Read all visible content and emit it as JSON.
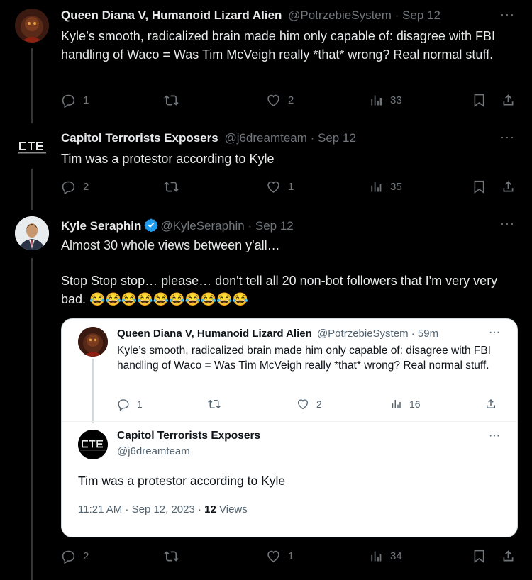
{
  "tweets": [
    {
      "name": "Queen Diana V, Humanoid Lizard Alien",
      "handle": "@PotrzebieSystem",
      "time": "Sep 12",
      "text": "Kyle’s smooth, radicalized brain made him only capable of: disagree with FBI handling of Waco = Was Tim McVeigh really *that* wrong? Real normal stuff.",
      "replies": "1",
      "retweets": "",
      "likes": "2",
      "views": "33"
    },
    {
      "name": "Capitol Terrorists Exposers",
      "handle": "@j6dreamteam",
      "time": "Sep 12",
      "text": "Tim was a protestor according to Kyle",
      "replies": "2",
      "retweets": "",
      "likes": "1",
      "views": "35"
    },
    {
      "name": "Kyle Seraphin",
      "handle": "@KyleSeraphin",
      "time": "Sep 12",
      "text_line1": "Almost 30 whole views between y'all…",
      "text_line2": "Stop Stop stop… please… don't tell all 20 non-bot followers that I'm very very bad. 😂😂😂😂😂😂😂😂😂😂",
      "replies": "2",
      "retweets": "",
      "likes": "1",
      "views": "34"
    }
  ],
  "quote": {
    "first": {
      "name": "Queen Diana V, Humanoid Lizard Alien",
      "handle": "@PotrzebieSystem",
      "time": "59m",
      "text": "Kyle’s smooth, radicalized brain made him only capable of: disagree with FBI handling of Waco = Was Tim McVeigh really *that* wrong? Real normal stuff.",
      "replies": "1",
      "likes": "2",
      "views": "16"
    },
    "second": {
      "name": "Capitol Terrorists Exposers",
      "handle": "@j6dreamteam",
      "text": "Tim was a protestor according to Kyle",
      "timestamp": "11:21 AM · Sep 12, 2023 · ",
      "views_count": "12",
      "views_label": " Views"
    }
  },
  "sep": " · ",
  "more_glyph": "···",
  "colors": {
    "background": "#000000",
    "muted": "#71767b",
    "verified": "#1d9bf0",
    "card": "#ffffff"
  }
}
